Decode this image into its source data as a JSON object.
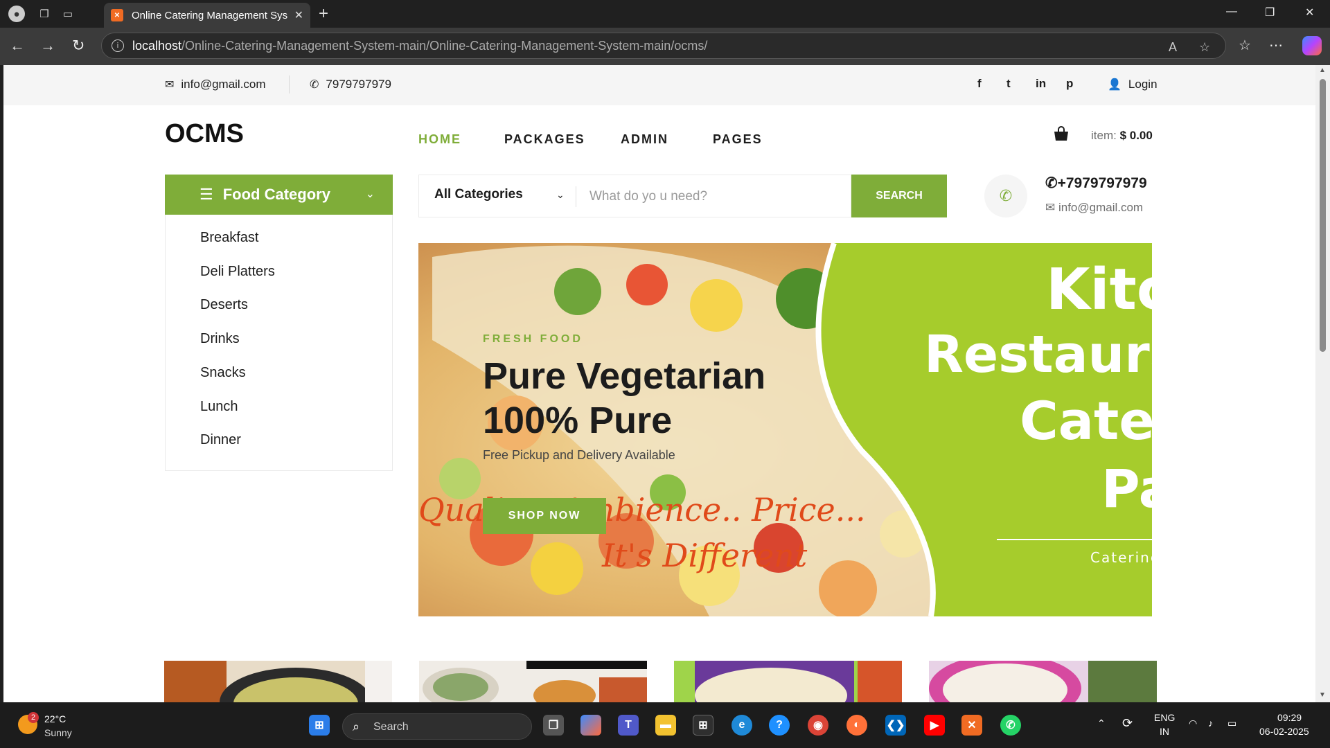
{
  "browser": {
    "tab_title": "Online Catering Management Sys",
    "url_host": "localhost",
    "url_path": "/Online-Catering-Management-System-main/Online-Catering-Management-System-main/ocms/"
  },
  "topbar": {
    "email": "info@gmail.com",
    "phone": "7979797979",
    "login": "Login"
  },
  "header": {
    "logo": "OCMS",
    "nav": [
      "HOME",
      "PACKAGES",
      "ADMIN",
      "PAGES"
    ],
    "cart_label": "item:",
    "cart_total": "$ 0.00"
  },
  "sidebar": {
    "title": "Food Category",
    "items": [
      "Breakfast",
      "Deli Platters",
      "Deserts",
      "Drinks",
      "Snacks",
      "Lunch",
      "Dinner"
    ]
  },
  "search": {
    "category": "All Categories",
    "placeholder": "What do yo u need?",
    "button": "SEARCH"
  },
  "contact": {
    "phone": "+7979797979",
    "email": "info@gmail.com"
  },
  "hero": {
    "tag": "FRESH FOOD",
    "title_line1": "Pure Vegetarian",
    "title_line2": "100% Pure",
    "subtitle": "Free Pickup and Delivery Available",
    "button": "SHOP NOW",
    "script_line1": "Quality.. Ambience.. Price...",
    "script_line2": "It's Different",
    "right_line1": "Kitch",
    "right_line2": "Restaura",
    "right_line3": "Cater",
    "right_line4": "Pa",
    "right_caption": "Catering"
  },
  "colors": {
    "accent": "#7fad39",
    "hero_green": "#a6cc2c"
  },
  "taskbar": {
    "temp": "22°C",
    "condition": "Sunny",
    "badge": "2",
    "search": "Search",
    "lang1": "ENG",
    "lang2": "IN",
    "time": "09:29",
    "date": "06-02-2025"
  }
}
